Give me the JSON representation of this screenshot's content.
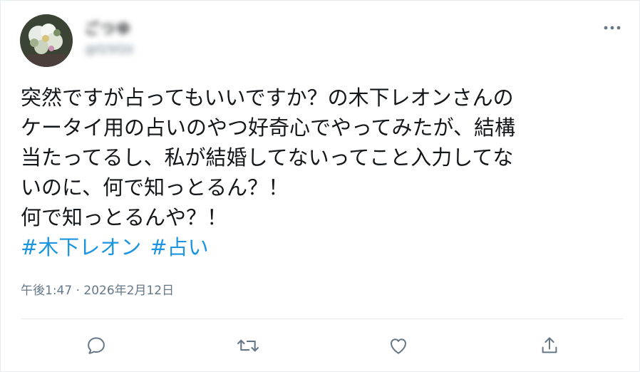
{
  "user": {
    "display_name": "ごつゆ",
    "handle": "@f25f20"
  },
  "tweet": {
    "text": "突然ですが占ってもいいですか？の木下レオンさんの\nケータイ用の占いのやつ好奇心でやってみたが、結構\n当たってるし、私が結婚してないってこと入力してな\nいのに、何で知っとるん？！\n何で知っとるんや？！",
    "hashtags": [
      "#木下レオン",
      "#占い"
    ],
    "timestamp": "午後1:47 · 2026年2月12日"
  },
  "actions": {
    "reply_icon": "reply-icon",
    "retweet_icon": "retweet-icon",
    "like_icon": "heart-icon",
    "share_icon": "share-icon"
  },
  "colors": {
    "text": "#14171a",
    "secondary": "#657786",
    "link": "#1b95e0",
    "divider": "#e6ecf0"
  }
}
